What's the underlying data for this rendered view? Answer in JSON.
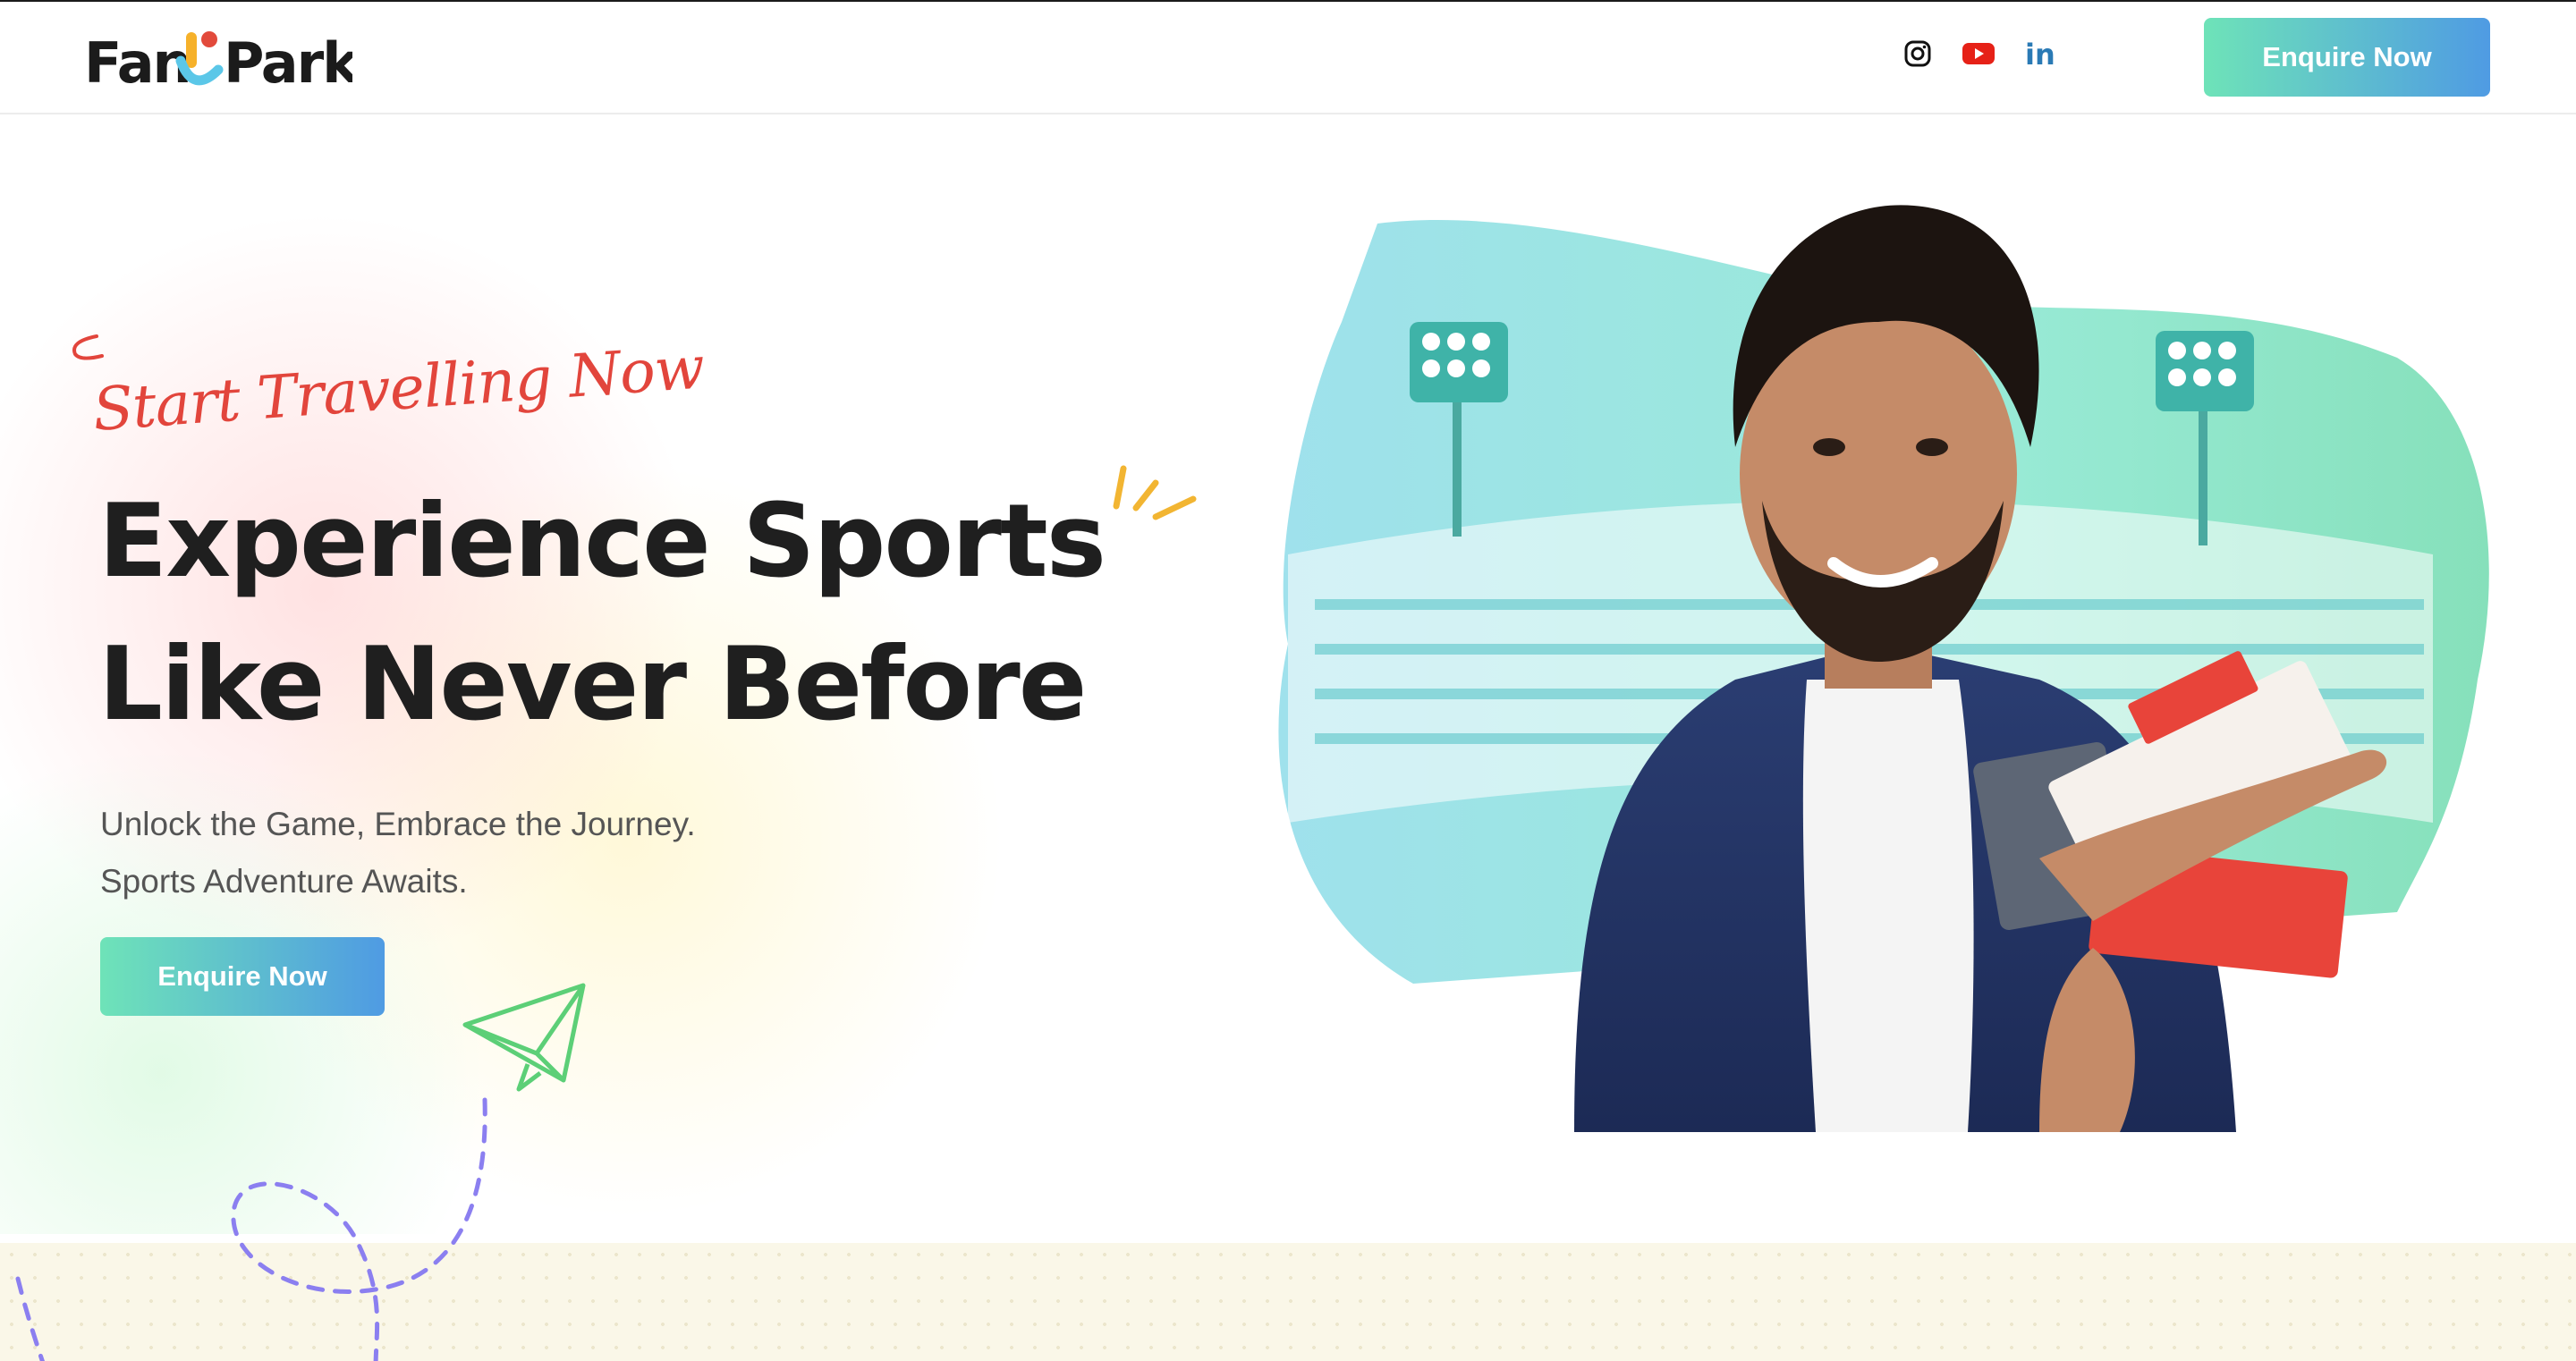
{
  "header": {
    "logo": "FantoPark",
    "social_icons": [
      "instagram-icon",
      "youtube-icon",
      "linkedin-icon"
    ],
    "cta_label": "Enquire Now"
  },
  "hero": {
    "script_tagline": "Start Travelling Now",
    "headline_line1": "Experience Sports",
    "headline_line2": "Like Never Before",
    "sub_line1": "Unlock the Game, Embrace the Journey.",
    "sub_line2": "Sports Adventure Awaits.",
    "cta_label": "Enquire Now",
    "image": "man-holding-passport-and-tickets-stadium-illustration"
  },
  "colors": {
    "cta_gradient_start": "#6ee3b8",
    "cta_gradient_end": "#4f9be3",
    "script_red": "#e2453c",
    "youtube_red": "#e62117",
    "linkedin_blue": "#2a7ab5"
  }
}
